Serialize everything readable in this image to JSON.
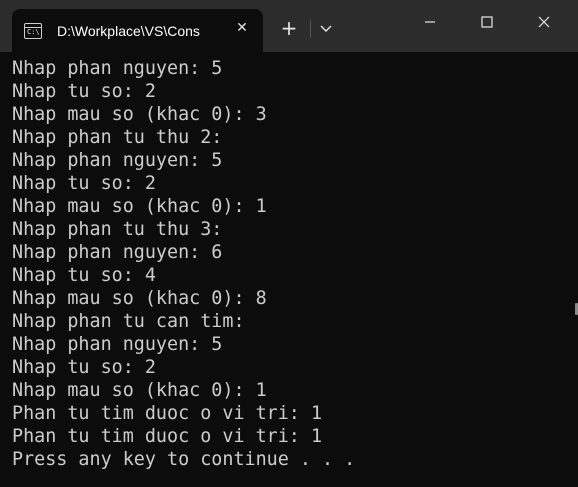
{
  "window": {
    "tab_title": "D:\\Workplace\\VS\\Cons",
    "tab_icon_text": "C:\\",
    "new_tab_label": "+",
    "close_tab_label": "✕"
  },
  "terminal": {
    "lines": [
      "Nhap phan nguyen: 5",
      "Nhap tu so: 2",
      "Nhap mau so (khac 0): 3",
      "Nhap phan tu thu 2:",
      "Nhap phan nguyen: 5",
      "Nhap tu so: 2",
      "Nhap mau so (khac 0): 1",
      "Nhap phan tu thu 3:",
      "Nhap phan nguyen: 6",
      "Nhap tu so: 4",
      "Nhap mau so (khac 0): 8",
      "Nhap phan tu can tim:",
      "Nhap phan nguyen: 5",
      "Nhap tu so: 2",
      "Nhap mau so (khac 0): 1",
      "Phan tu tim duoc o vi tri: 1",
      "Phan tu tim duoc o vi tri: 1",
      "Press any key to continue . . ."
    ]
  },
  "colors": {
    "titlebar_bg": "#2c2c2c",
    "terminal_bg": "#0c0c0c",
    "terminal_text": "#cccccc"
  }
}
